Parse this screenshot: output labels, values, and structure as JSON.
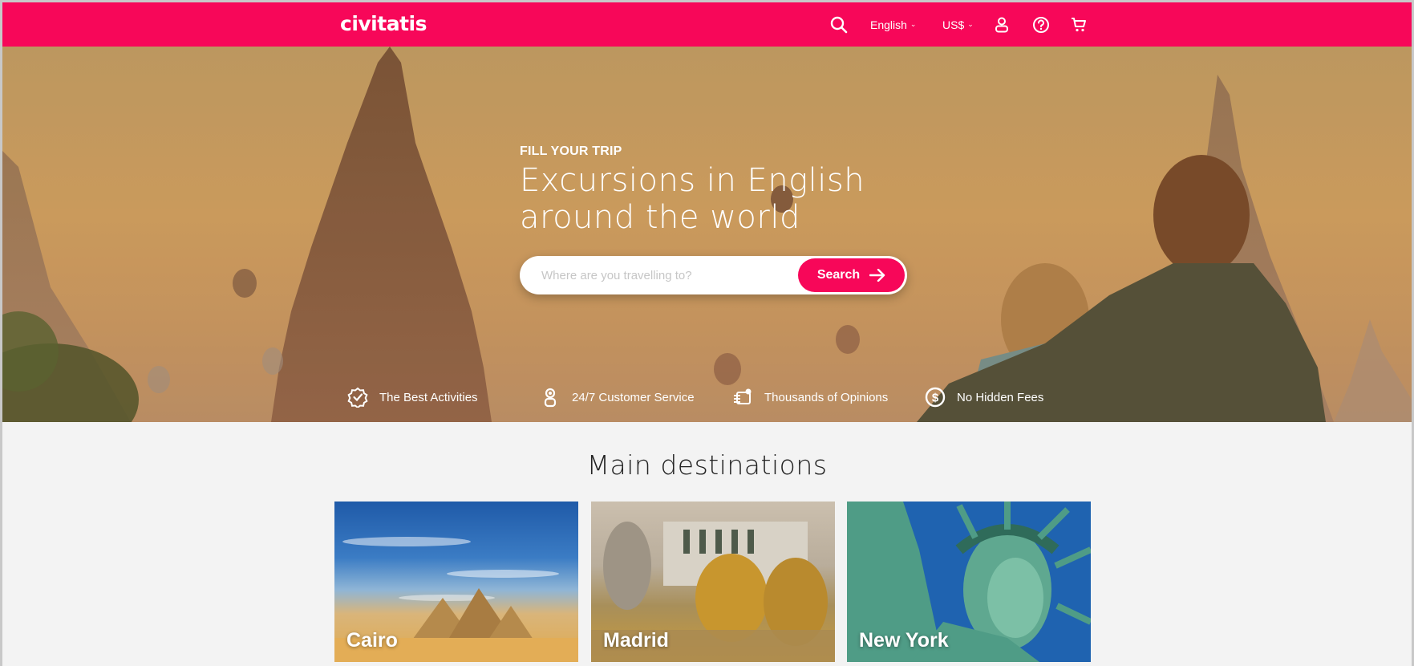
{
  "header": {
    "logo": "civitatis",
    "brand_color": "#f70759",
    "nav": {
      "search_icon": "search-icon",
      "language": "English",
      "currency": "US$",
      "user_icon": "user-icon",
      "help_icon": "help-icon",
      "cart_icon": "cart-icon"
    }
  },
  "hero": {
    "eyebrow": "FILL YOUR TRIP",
    "title_line1": "Excursions in English",
    "title_line2": "around the world",
    "search": {
      "placeholder": "Where are you travelling to?",
      "value": "",
      "button_label": "Search",
      "button_icon": "arrow-right-icon"
    },
    "features": [
      {
        "icon": "verified-badge-icon",
        "label": "The Best Activities"
      },
      {
        "icon": "customer-service-icon",
        "label": "24/7 Customer Service"
      },
      {
        "icon": "opinions-icon",
        "label": "Thousands of Opinions"
      },
      {
        "icon": "dollar-icon",
        "label": "No Hidden Fees"
      }
    ]
  },
  "destinations": {
    "title": "Main destinations",
    "items": [
      {
        "name": "Cairo"
      },
      {
        "name": "Madrid"
      },
      {
        "name": "New York"
      }
    ]
  }
}
